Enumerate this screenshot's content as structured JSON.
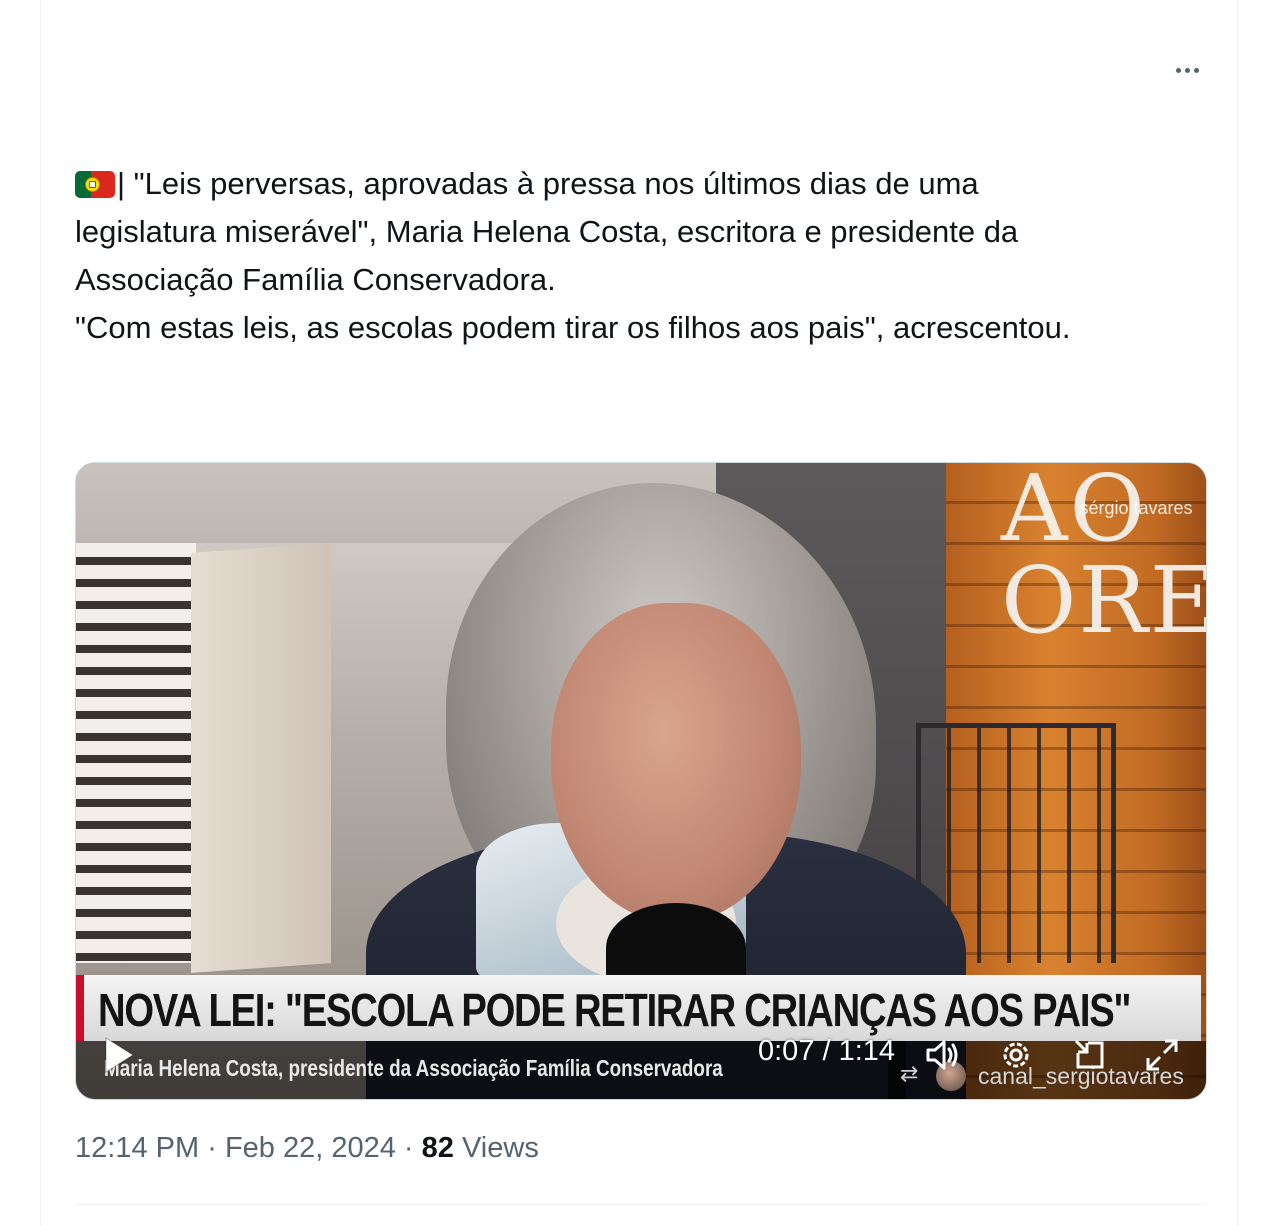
{
  "tweet": {
    "more_icon": "more-horizontal-icon",
    "flag_icon": "portugal-flag-emoji",
    "text_lines": [
      "| \"Leis perversas, aprovadas à pressa nos últimos dias de uma",
      "legislatura miserável\", Maria Helena Costa, escritora e presidente da",
      "Associação Família Conservadora.",
      "\"Com estas leis, as escolas podem tirar os filhos aos pais\", acrescentou."
    ],
    "video": {
      "store_sign": "AO\nORE",
      "watermark": "sérgio tavares",
      "headline": "NOVA LEI: \"ESCOLA PODE RETIRAR CRIANÇAS AOS PAIS\"",
      "subline": "Maria Helena Costa, presidente da Associação Família Conservadora",
      "source": "canal_sergiotavares",
      "time": "0:07 / 1:14",
      "controls": {
        "play_icon": "play-icon",
        "volume_icon": "volume-icon",
        "settings_icon": "gear-icon",
        "pip_icon": "picture-in-picture-icon",
        "fullscreen_icon": "fullscreen-icon"
      }
    },
    "meta": {
      "time": "12:14 PM",
      "separator": "·",
      "date": "Feb 22, 2024",
      "views_count": "82",
      "views_label": "Views"
    }
  },
  "colors": {
    "text": "#0f1419",
    "secondary": "#536471",
    "border": "#eff3f4",
    "accent_red": "#c8102e"
  }
}
